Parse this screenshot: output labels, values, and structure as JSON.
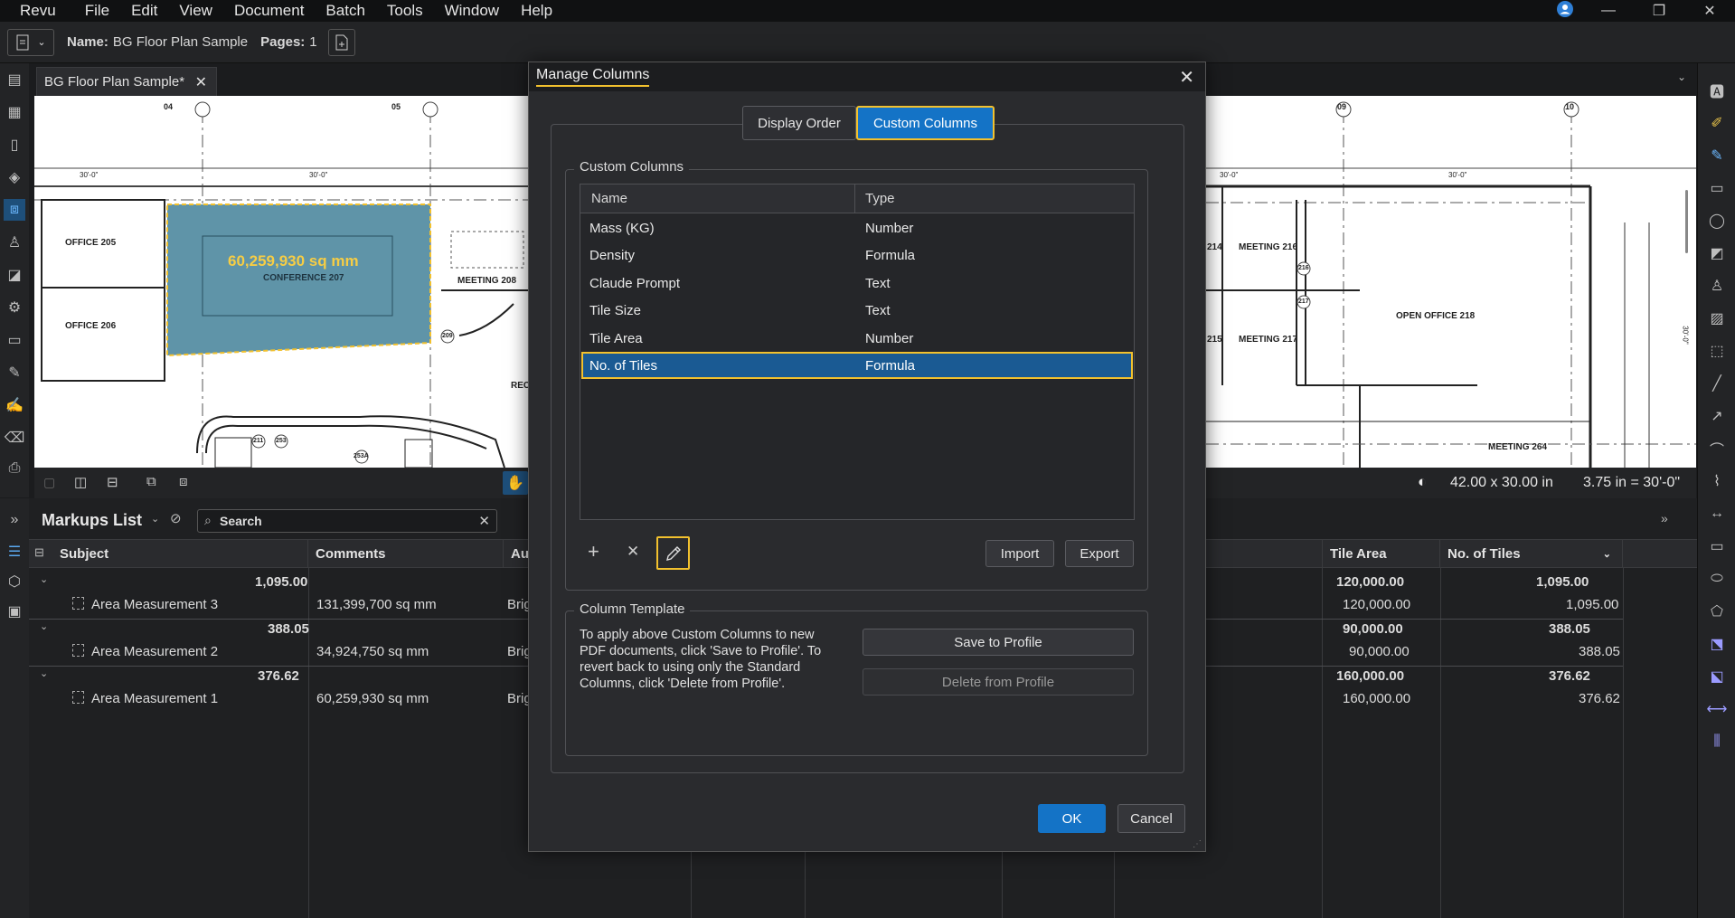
{
  "menubar": {
    "items": [
      "Revu",
      "File",
      "Edit",
      "View",
      "Document",
      "Batch",
      "Tools",
      "Window",
      "Help"
    ]
  },
  "window_controls": {
    "minimize": "—",
    "restore": "❐",
    "close": "✕"
  },
  "docbar": {
    "name_label": "Name:",
    "name_value": "BG Floor Plan Sample",
    "pages_label": "Pages:",
    "pages_value": "1"
  },
  "tab": {
    "label": "BG Floor Plan Sample*"
  },
  "plan_left": {
    "grid_bubbles": [
      "04",
      "05"
    ],
    "dims": [
      "30'-0\"",
      "30'-0\""
    ],
    "rooms": [
      "OFFICE 205",
      "OFFICE 206",
      "MEETING 208",
      "REC"
    ],
    "measurement_value": "60,259,930 sq mm",
    "measurement_room": "CONFERENCE 207",
    "door_tags": [
      "209",
      "211",
      "253",
      "253A"
    ]
  },
  "plan_right": {
    "grid_bubbles": [
      "09",
      "10"
    ],
    "dims": [
      "30'-0\"",
      "30'-0\"",
      "30'-0\""
    ],
    "rooms": [
      "214",
      "MEETING 216",
      "OPEN OFFICE 218",
      "215",
      "MEETING 217",
      "MEETING 264"
    ],
    "door_tags": [
      "216",
      "217"
    ]
  },
  "statusbar": {
    "size": "42.00 x 30.00 in",
    "scale": "3.75 in = 30'-0\""
  },
  "markups": {
    "title": "Markups List",
    "search_placeholder": "Search",
    "columns": [
      "Subject",
      "Comments",
      "Au",
      "Tile Area",
      "No. of Tiles"
    ],
    "groups": [
      {
        "total_tiles": "1,095.00",
        "tile_area_total": "120,000.00",
        "tiles_total": "1,095.00",
        "item": {
          "subject": "Area Measurement 3",
          "comments": "131,399,700 sq mm",
          "author": "Brig",
          "tile_area": "120,000.00",
          "tiles": "1,095.00"
        }
      },
      {
        "total_tiles": "388.05",
        "tile_area_total": "90,000.00",
        "tiles_total": "388.05",
        "item": {
          "subject": "Area Measurement 2",
          "comments": "34,924,750 sq mm",
          "author": "Brig",
          "tile_area": "90,000.00",
          "tiles": "388.05"
        }
      },
      {
        "total_tiles": "376.62",
        "tile_area_total": "160,000.00",
        "tiles_total": "376.62",
        "item": {
          "subject": "Area Measurement 1",
          "comments": "60,259,930 sq mm",
          "author": "Brig",
          "tile_area": "160,000.00",
          "tiles": "376.62"
        }
      }
    ]
  },
  "dialog": {
    "title": "Manage Columns",
    "tabs": [
      "Display Order",
      "Custom Columns"
    ],
    "active_tab": "Custom Columns",
    "custom_columns_legend": "Custom Columns",
    "table_headers": [
      "Name",
      "Type"
    ],
    "rows": [
      {
        "name": "Mass (KG)",
        "type": "Number"
      },
      {
        "name": "Density",
        "type": "Formula"
      },
      {
        "name": "Claude Prompt",
        "type": "Text"
      },
      {
        "name": "Tile Size",
        "type": "Text"
      },
      {
        "name": "Tile Area",
        "type": "Number"
      },
      {
        "name": "No. of Tiles",
        "type": "Formula"
      }
    ],
    "selected_row": "No. of Tiles",
    "add_btn": "+",
    "delete_btn": "✕",
    "import_btn": "Import",
    "export_btn": "Export",
    "template_legend": "Column Template",
    "template_text": "To apply above Custom Columns to new PDF documents, click 'Save to Profile'. To revert back to using only the Standard Columns, click 'Delete from Profile'.",
    "save_btn": "Save to Profile",
    "delete_profile_btn": "Delete from Profile",
    "ok_btn": "OK",
    "cancel_btn": "Cancel"
  },
  "colors": {
    "accent_blue": "#1473c6",
    "highlight_yellow": "#f2c12e",
    "selected_row": "#1a5a93",
    "measure_fill": "#5f94a8"
  }
}
